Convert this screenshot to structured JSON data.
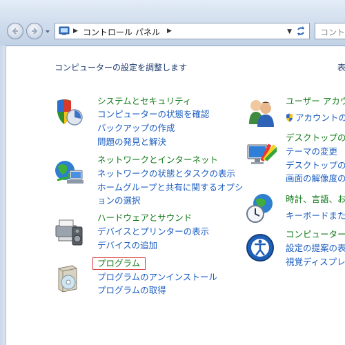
{
  "address": {
    "crumbs": [
      "コントロール パネル"
    ],
    "search_placeholder": "コントロ"
  },
  "main": {
    "heading": "コンピューターの設定を調整します",
    "view_by_label": "表",
    "left_categories": [
      {
        "title": "システムとセキュリティ",
        "links": [
          "コンピューターの状態を確認",
          "バックアップの作成",
          "問題の発見と解決"
        ]
      },
      {
        "title": "ネットワークとインターネット",
        "links": [
          "ネットワークの状態とタスクの表示",
          "ホームグループと共有に関するオプシ",
          "ョンの選択"
        ]
      },
      {
        "title": "ハードウェアとサウンド",
        "links": [
          "デバイスとプリンターの表示",
          "デバイスの追加"
        ]
      },
      {
        "title": "プログラム",
        "links": [
          "プログラムのアンインストール",
          "プログラムの取得"
        ]
      }
    ],
    "right_categories": [
      {
        "title": "ユーザー アカウ",
        "links": [
          "アカウントの"
        ]
      },
      {
        "title": "デスクトップの",
        "links": [
          "テーマの変更",
          "デスクトップの",
          "画面の解像度の"
        ]
      },
      {
        "title": "時計、言語、お",
        "links": [
          "キーボードまた"
        ]
      },
      {
        "title": "コンピューター",
        "links": [
          "設定の提案の表",
          "視覚ディスプレ"
        ]
      }
    ]
  }
}
